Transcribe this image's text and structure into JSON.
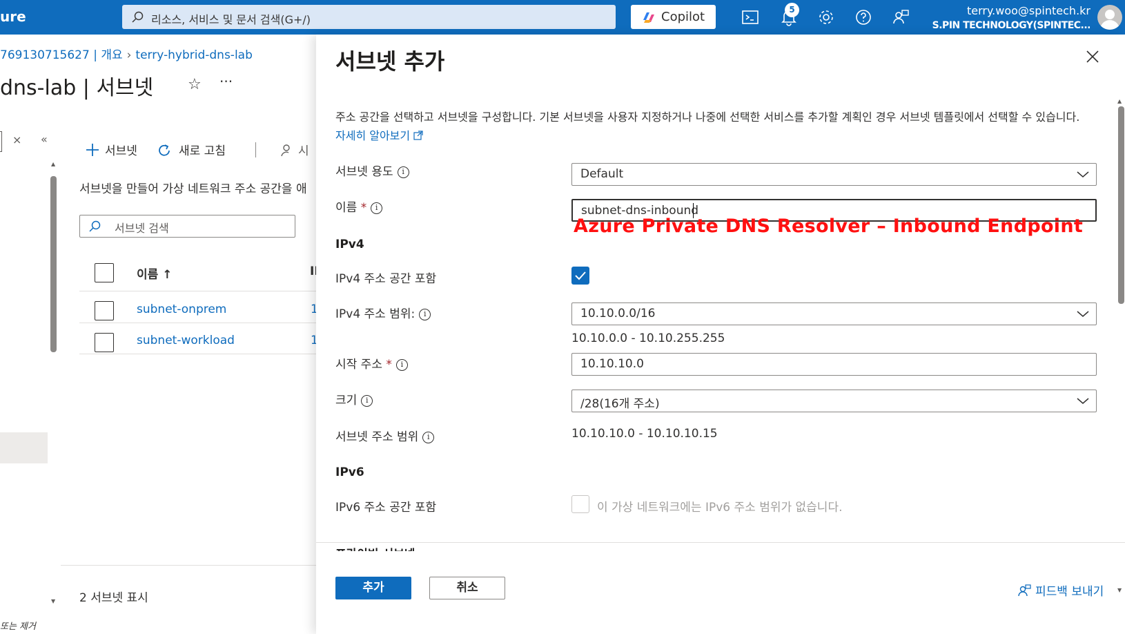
{
  "topbar": {
    "brand": "ure",
    "search_placeholder": "리소스, 서비스 및 문서 검색(G+/)",
    "copilot_label": "Copilot",
    "notification_count": "5",
    "user_email": "terry.woo@spintech.kr",
    "user_org": "S.PIN TECHNOLOGY(SPINTEC..."
  },
  "breadcrumb": {
    "part1": "769130715627 | 개요",
    "part2": "terry-hybrid-dns-lab"
  },
  "page": {
    "title": "dns-lab | 서브넷",
    "star": "☆",
    "more": "···"
  },
  "commands": {
    "add_subnet": "서브넷",
    "refresh": "새로 고침",
    "users": "시"
  },
  "left_panel": {
    "description": "서브넷을 만들어 가상 네트워크 주소 공간을 애",
    "search_placeholder": "서브넷 검색",
    "col_name": "이름 ↑",
    "col_ip": "II",
    "rows": [
      {
        "name": "subnet-onprem",
        "num": "1"
      },
      {
        "name": "subnet-workload",
        "num": "1"
      }
    ],
    "count": "2 서브넷 표시",
    "bottom_text": "또는 제거"
  },
  "pane": {
    "title": "서브넷 추가",
    "intro": "주소 공간을 선택하고 서브넷을 구성합니다. 기본 서브넷을 사용자 지정하거나 나중에 선택한 서비스를 추가할 계획인 경우 서브넷 템플릿에서 선택할 수 있습니다.",
    "learn_more": "자세히 알아보기",
    "fields": {
      "purpose_label": "서브넷 용도",
      "purpose_value": "Default",
      "name_label": "이름",
      "name_value": "subnet-dns-inbound",
      "annotation": "Azure Private DNS Resolver – Inbound Endpoint",
      "ipv4_section": "IPv4",
      "ipv4_include_label": "IPv4 주소 공간 포함",
      "ipv4_range_label": "IPv4 주소 범위:",
      "ipv4_range_value": "10.10.0.0/16",
      "ipv4_range_span": "10.10.0.0 - 10.10.255.255",
      "start_label": "시작 주소",
      "start_value": "10.10.10.0",
      "size_label": "크기",
      "size_value": "/28(16개 주소)",
      "subnet_range_label": "서브넷 주소 범위",
      "subnet_range_value": "10.10.10.0 - 10.10.10.15",
      "ipv6_section": "IPv6",
      "ipv6_include_label": "IPv6 주소 공간 포함",
      "ipv6_note": "이 가상 네트워크에는 IPv6 주소 범위가 없습니다.",
      "cut_section": "프라이빗 서브넷"
    },
    "add_button": "추가",
    "cancel_button": "취소",
    "feedback": "피드백 보내기"
  },
  "colors": {
    "brand_blue": "#0f6cbd",
    "annotation_red": "#ff1010"
  }
}
